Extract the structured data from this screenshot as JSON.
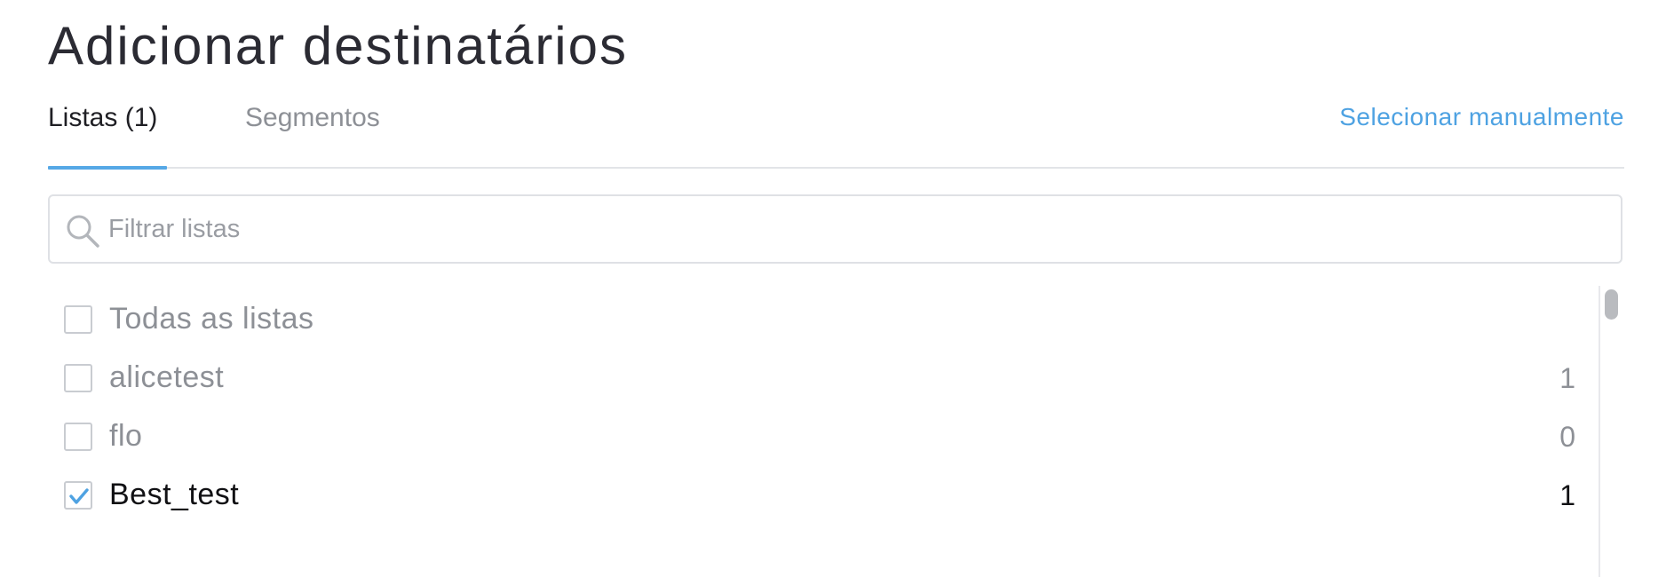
{
  "page": {
    "title": "Adicionar destinatários"
  },
  "tabs": {
    "lists_label": "Listas (1)",
    "segments_label": "Segmentos",
    "active": "lists"
  },
  "header": {
    "manual_select_label": "Selecionar manualmente"
  },
  "search": {
    "placeholder": "Filtrar listas",
    "value": ""
  },
  "lists": {
    "all_label": "Todas as listas",
    "all_checked": false,
    "items": [
      {
        "label": "alicetest",
        "count": "1",
        "checked": false
      },
      {
        "label": "flo",
        "count": "0",
        "checked": false
      },
      {
        "label": "Best_test",
        "count": "1",
        "checked": true
      }
    ]
  },
  "colors": {
    "accent": "#4ea2e2",
    "muted_text": "#8d9096",
    "title_text": "#2b2b33",
    "checkbox_border": "#c9ccd1"
  },
  "icons": {
    "search": "search-icon",
    "check": "checkmark-icon"
  }
}
